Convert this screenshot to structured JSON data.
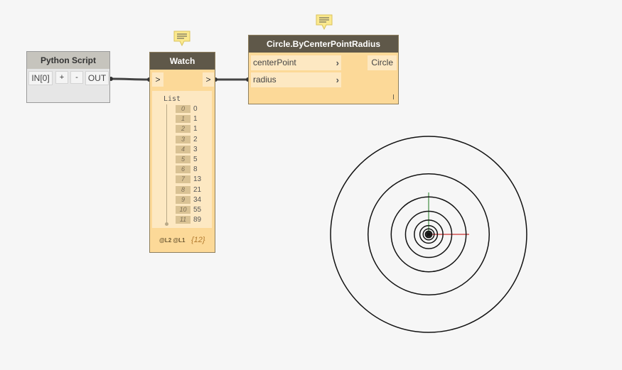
{
  "python_node": {
    "title": "Python Script",
    "input": "IN[0]",
    "add": "+",
    "remove": "-",
    "output": "OUT"
  },
  "watch_node": {
    "title": "Watch",
    "in_port": ">",
    "out_port": ">",
    "list_label": "List",
    "items": [
      {
        "index": "0",
        "value": "0"
      },
      {
        "index": "1",
        "value": "1"
      },
      {
        "index": "2",
        "value": "1"
      },
      {
        "index": "3",
        "value": "2"
      },
      {
        "index": "4",
        "value": "3"
      },
      {
        "index": "5",
        "value": "5"
      },
      {
        "index": "6",
        "value": "8"
      },
      {
        "index": "7",
        "value": "13"
      },
      {
        "index": "8",
        "value": "21"
      },
      {
        "index": "9",
        "value": "34"
      },
      {
        "index": "10",
        "value": "55"
      },
      {
        "index": "11",
        "value": "89"
      }
    ],
    "levels": "@L2 @L1",
    "count": "{12}"
  },
  "circle_node": {
    "title": "Circle.ByCenterPointRadius",
    "inputs": [
      "centerPoint",
      "radius"
    ],
    "output": "Circle"
  },
  "preview": {
    "radii": [
      0,
      1,
      1,
      2,
      3,
      5,
      8,
      13,
      21,
      34,
      55,
      89
    ]
  },
  "icons": [
    "note-icon",
    "chevron-right-icon"
  ]
}
